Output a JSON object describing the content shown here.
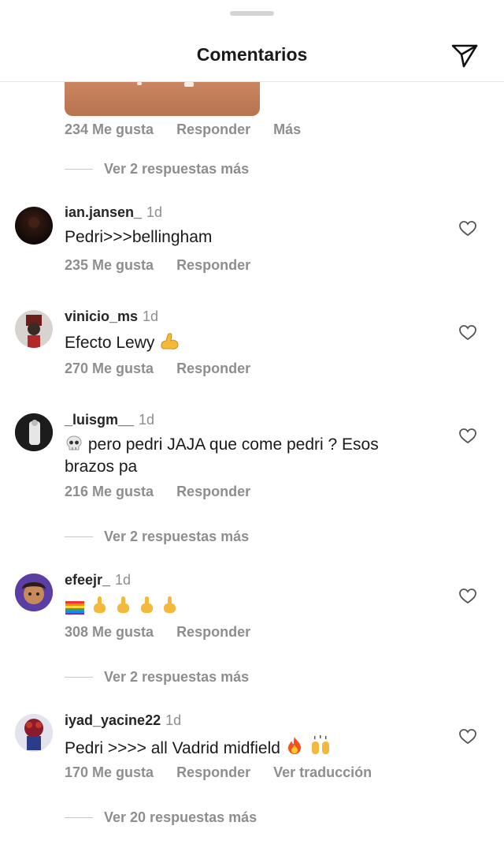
{
  "header": {
    "title": "Comentarios",
    "send_icon": "paper-plane-icon"
  },
  "top_comment": {
    "likes": "234 Me gusta",
    "reply_label": "Responder",
    "more_label": "Más",
    "view_replies": "Ver 2 respuestas más"
  },
  "comments": [
    {
      "username": "ian.jansen_",
      "time": "1d",
      "text": "Pedri>>>bellingham",
      "likes": "235 Me gusta",
      "reply_label": "Responder"
    },
    {
      "username": "vinicio_ms",
      "time": "1d",
      "text": "Efecto Lewy",
      "emoji": "flexed-biceps",
      "likes": "270 Me gusta",
      "reply_label": "Responder"
    },
    {
      "username": "_luisgm__",
      "time": "1d",
      "text_line1": "pero pedri JAJA que come pedri ? Esos",
      "text_line2": "brazos pa",
      "emoji": "skull",
      "likes": "216 Me gusta",
      "reply_label": "Responder",
      "view_replies": "Ver 2 respuestas más"
    },
    {
      "username": "efeejr_",
      "time": "1d",
      "emoji": "rainbow-flag + 4x middle-finger",
      "likes": "308 Me gusta",
      "reply_label": "Responder",
      "view_replies": "Ver 2 respuestas más"
    },
    {
      "username": "iyad_yacine22",
      "time": "1d",
      "text": "Pedri >>>> all Vadrid midfield",
      "emoji": "fire + raising-hands",
      "likes": "170 Me gusta",
      "reply_label": "Responder",
      "translate_label": "Ver traducción",
      "view_replies": "Ver 20 respuestas más"
    }
  ],
  "colors": {
    "text": "#262626",
    "muted": "#8e8e8e",
    "divider": "#e6e6e6"
  }
}
